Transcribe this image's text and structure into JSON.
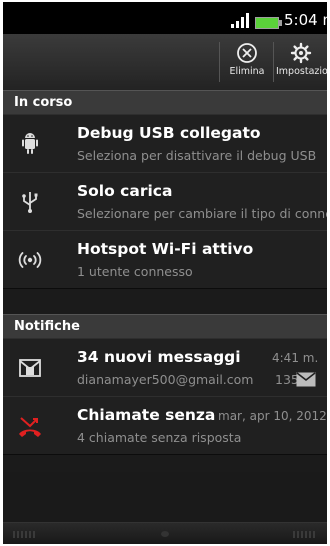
{
  "status_bar": {
    "time": "5:04",
    "time_suffix": "m."
  },
  "action_bar": {
    "delete_label": "Elimina",
    "settings_label": "Impostazioni"
  },
  "sections": {
    "ongoing": "In corso",
    "notifications": "Notifiche"
  },
  "ongoing": [
    {
      "icon": "android-debug-icon",
      "title": "Debug USB collegato",
      "subtitle": "Seleziona per disattivare il debug USB"
    },
    {
      "icon": "usb-icon",
      "title": "Solo carica",
      "subtitle": "Selezionare per cambiare il tipo di connessione"
    },
    {
      "icon": "wifi-hotspot-icon",
      "title": "Hotspot Wi-Fi attivo",
      "subtitle": "1 utente connesso"
    }
  ],
  "notifications": [
    {
      "icon": "mail-icon",
      "title": "34 nuovi messaggi",
      "time": "4:41 m.",
      "subtitle": "dianamayer500@gmail.com",
      "count": "135"
    },
    {
      "icon": "missed-call-icon",
      "title": "Chiamate senza",
      "time": "mar, apr 10, 2012",
      "subtitle": "4 chiamate senza risposta"
    }
  ],
  "colors": {
    "battery": "#5bd13a",
    "missed_call": "#e02020",
    "background": "#1b1b1b"
  }
}
